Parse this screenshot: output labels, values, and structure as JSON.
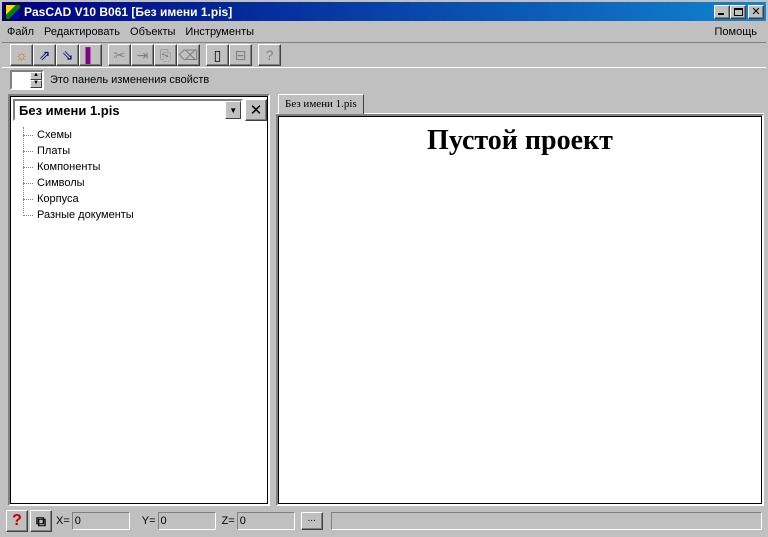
{
  "window": {
    "title": "PasCAD V10 B061 [Без имени 1.pis]",
    "icon": "pascad-app-icon",
    "close_glyph": "✕"
  },
  "menu": {
    "items": [
      "Файл",
      "Редактировать",
      "Объекты",
      "Инструменты"
    ],
    "help": "Помощь"
  },
  "toolbar": {
    "buttons": [
      {
        "icon": "new-project-icon",
        "glyph": "☼",
        "enabled": true
      },
      {
        "icon": "open-icon",
        "glyph": "⇗",
        "enabled": true
      },
      {
        "icon": "save-icon",
        "glyph": "⇘",
        "enabled": true
      },
      {
        "icon": "exit-door-icon",
        "glyph": "▌",
        "enabled": true
      },
      {
        "icon": "cut-icon",
        "glyph": "✂",
        "enabled": false
      },
      {
        "icon": "copy-icon",
        "glyph": "⇥",
        "enabled": false
      },
      {
        "icon": "paste-icon",
        "glyph": "⎘",
        "enabled": false
      },
      {
        "icon": "delete-icon",
        "glyph": "⌫",
        "enabled": false
      },
      {
        "icon": "page-icon",
        "glyph": "▯",
        "enabled": true
      },
      {
        "icon": "layout-icon",
        "glyph": "⊟",
        "enabled": false
      },
      {
        "icon": "help-icon",
        "glyph": "?",
        "enabled": false
      }
    ]
  },
  "property_panel": {
    "spin_value": "",
    "label": "Это панель изменения свойств"
  },
  "project": {
    "name": "Без имени 1.pis",
    "close_glyph": "✕",
    "tree": [
      "Схемы",
      "Платы",
      "Компоненты",
      "Символы",
      "Корпуса",
      "Разные документы"
    ]
  },
  "document": {
    "tab_label": "Без имени 1.pis",
    "title": "Пустой проект"
  },
  "statusbar": {
    "help_glyph": "?",
    "x_label": "X=",
    "x_value": "0",
    "y_label": "Y=",
    "y_value": "0",
    "z_label": "Z=",
    "z_value": "0",
    "dots_label": "...",
    "message": ""
  }
}
